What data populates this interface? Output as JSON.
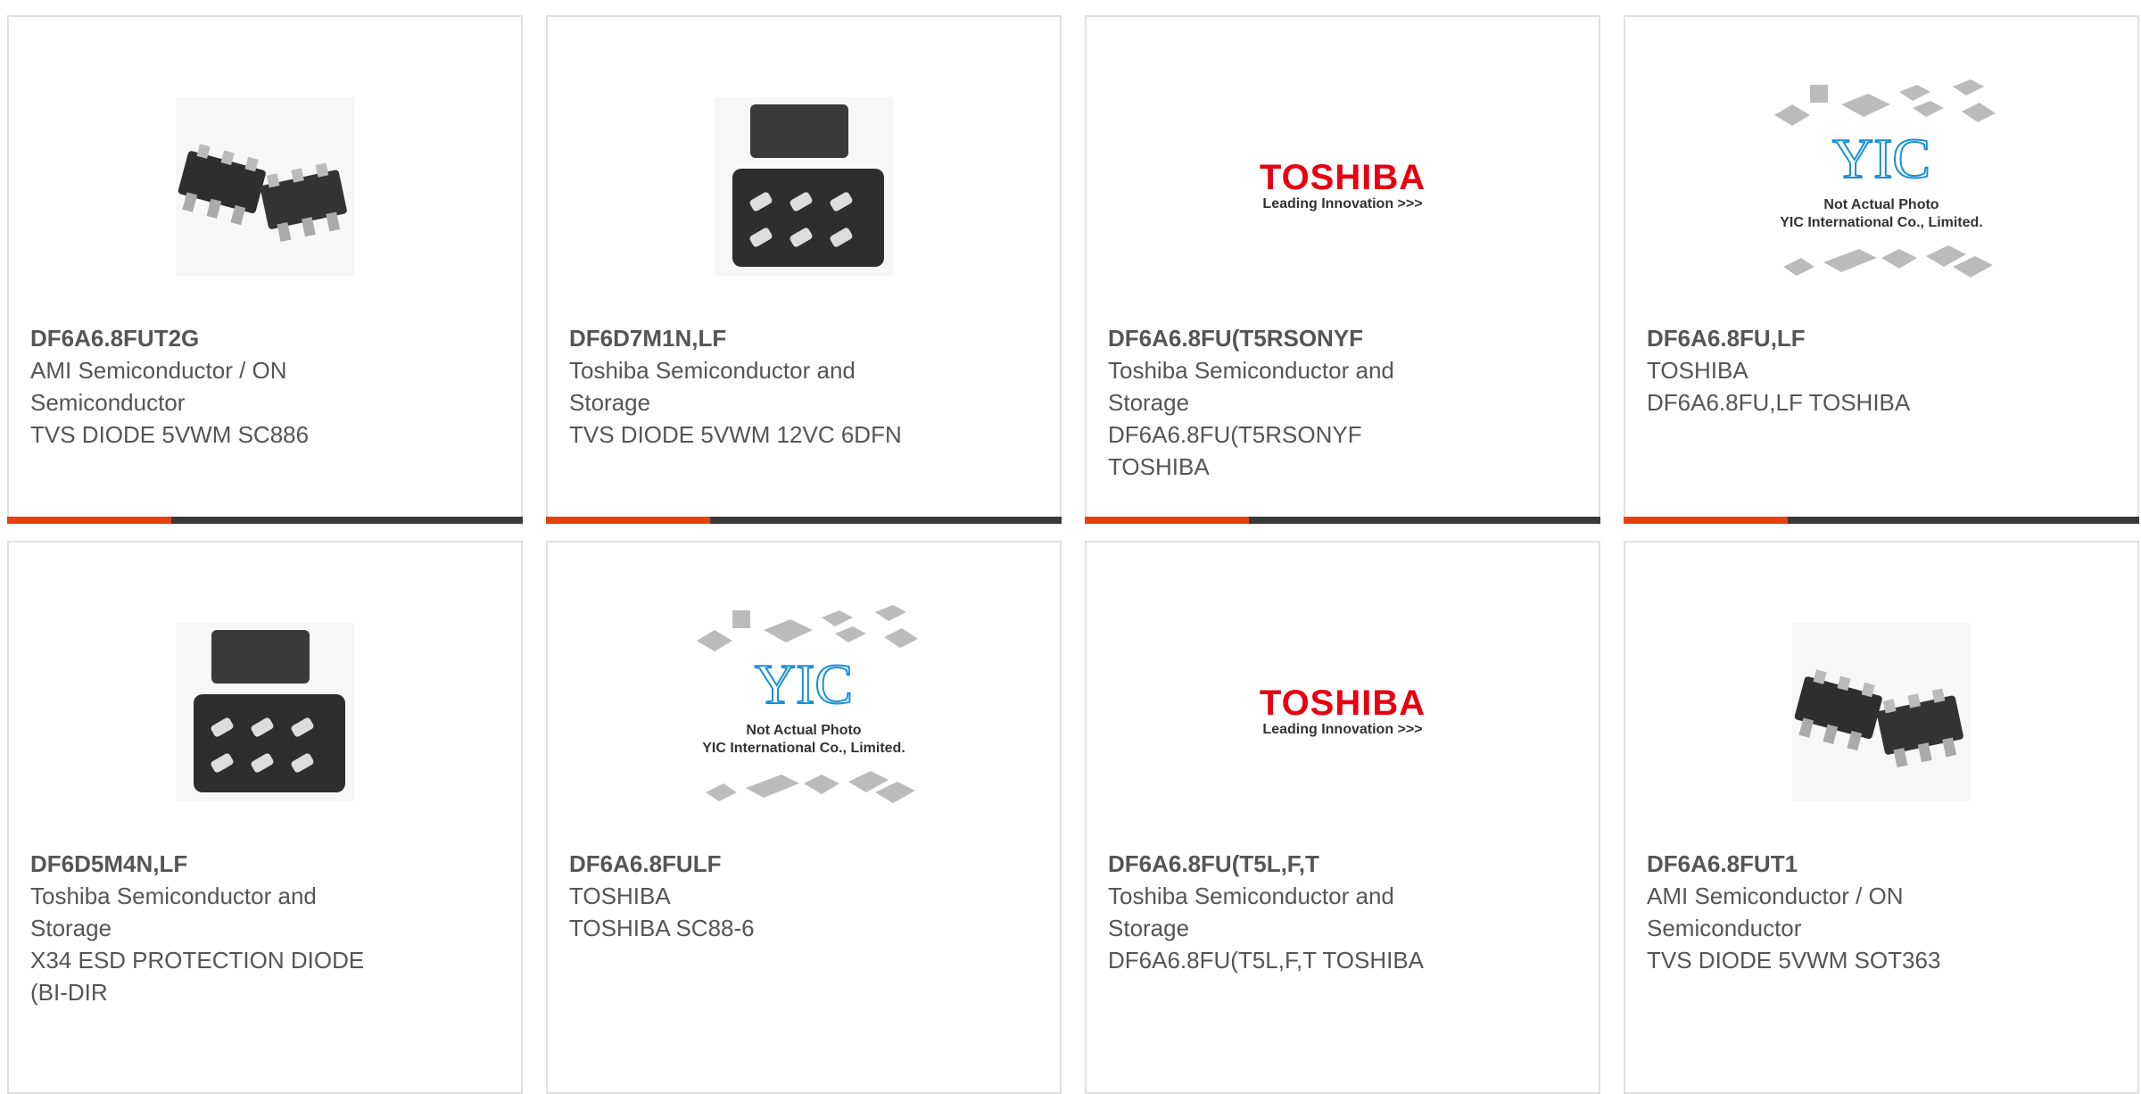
{
  "products": [
    {
      "part_number": "DF6A6.8FUT2G",
      "manufacturer_lines": [
        "AMI Semiconductor / ON",
        "Semiconductor"
      ],
      "description_lines": [
        "TVS DIODE 5VWM SC886"
      ],
      "image": "sot363-chip-photo",
      "has_bar": true
    },
    {
      "part_number": "DF6D7M1N,LF",
      "manufacturer_lines": [
        "Toshiba Semiconductor and",
        "Storage"
      ],
      "description_lines": [
        "TVS DIODE 5VWM 12VC 6DFN"
      ],
      "image": "dfn-chip-photo",
      "has_bar": true
    },
    {
      "part_number": "DF6A6.8FU(T5RSONYF",
      "manufacturer_lines": [
        "Toshiba Semiconductor and",
        "Storage"
      ],
      "description_lines": [
        "DF6A6.8FU(T5RSONYF",
        "TOSHIBA"
      ],
      "image": "toshiba-logo",
      "has_bar": true
    },
    {
      "part_number": "DF6A6.8FU,LF",
      "manufacturer_lines": [
        "TOSHIBA"
      ],
      "description_lines": [
        "DF6A6.8FU,LF TOSHIBA"
      ],
      "image": "yic-placeholder",
      "has_bar": true
    },
    {
      "part_number": "DF6D5M4N,LF",
      "manufacturer_lines": [
        "Toshiba Semiconductor and",
        "Storage"
      ],
      "description_lines": [
        "X34 ESD PROTECTION DIODE",
        "(BI-DIR"
      ],
      "image": "dfn-chip-photo",
      "has_bar": false
    },
    {
      "part_number": "DF6A6.8FULF",
      "manufacturer_lines": [
        "TOSHIBA"
      ],
      "description_lines": [
        "TOSHIBA SC88-6"
      ],
      "image": "yic-placeholder",
      "has_bar": false
    },
    {
      "part_number": "DF6A6.8FU(T5L,F,T",
      "manufacturer_lines": [
        "Toshiba Semiconductor and",
        "Storage"
      ],
      "description_lines": [
        "DF6A6.8FU(T5L,F,T TOSHIBA"
      ],
      "image": "toshiba-logo",
      "has_bar": false
    },
    {
      "part_number": "DF6A6.8FUT1",
      "manufacturer_lines": [
        "AMI Semiconductor / ON",
        "Semiconductor"
      ],
      "description_lines": [
        "TVS DIODE 5VWM SOT363"
      ],
      "image": "sot363-chip-photo",
      "has_bar": false
    }
  ],
  "logos": {
    "toshiba_word": "TOSHIBA",
    "toshiba_tagline": "Leading Innovation >>>",
    "yic_mark": "YIC",
    "yic_line1": "Not Actual Photo",
    "yic_line2": "YIC International Co., Limited."
  },
  "colors": {
    "accent": "#e8400c",
    "bar": "#3a3a3a",
    "border": "#e0e0e0",
    "text": "#555555",
    "toshiba_red": "#e60012",
    "yic_blue": "#1a8fd6"
  }
}
